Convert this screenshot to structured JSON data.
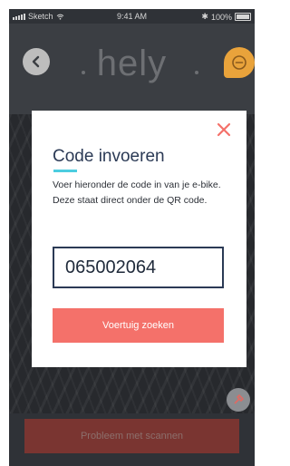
{
  "status_bar": {
    "carrier": "Sketch",
    "time": "9:41 AM",
    "battery": "100%"
  },
  "header": {
    "logo": "hely"
  },
  "modal": {
    "title": "Code invoeren",
    "description": "Voer hieronder de code in van je e-bike. Deze staat direct onder de QR code.",
    "code_value": "065002064",
    "search_label": "Voertuig zoeken"
  },
  "scanner": {
    "problem_label": "Probleem met scannen"
  },
  "colors": {
    "accent": "#f4716a",
    "title": "#2b3a55",
    "underline": "#4ccde0",
    "help": "#e9a33b"
  },
  "icons": [
    "back-chevron-icon",
    "help-icon",
    "close-icon",
    "flashlight-icon",
    "signal-icon",
    "wifi-icon",
    "battery-icon"
  ]
}
